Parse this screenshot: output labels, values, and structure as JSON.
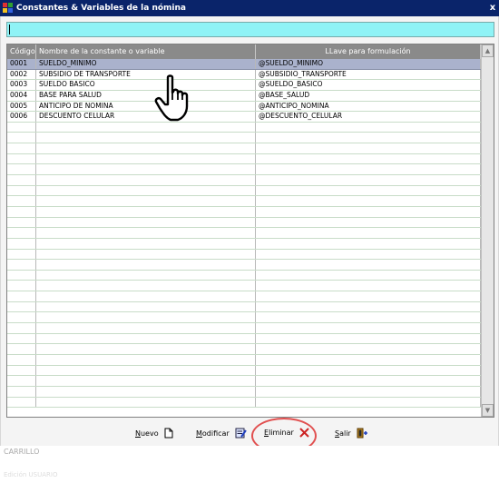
{
  "window": {
    "title": "Constantes & Variables de la nómina",
    "close_label": "x"
  },
  "search": {
    "value": ""
  },
  "grid": {
    "columns": [
      "Código",
      "Nombre de la constante o variable",
      "LLave para formulación"
    ],
    "rows": [
      {
        "codigo": "0001",
        "nombre": "SUELDO_MINIMO",
        "llave": "@SUELDO_MINIMO"
      },
      {
        "codigo": "0002",
        "nombre": "SUBSIDIO DE TRANSPORTE",
        "llave": "@SUBSIDIO_TRANSPORTE"
      },
      {
        "codigo": "0003",
        "nombre": "SUELDO BASICO",
        "llave": "@SUELDO_BASICO"
      },
      {
        "codigo": "0004",
        "nombre": "BASE PARA SALUD",
        "llave": "@BASE_SALUD"
      },
      {
        "codigo": "0005",
        "nombre": "ANTICIPO DE NOMINA",
        "llave": "@ANTICIPO_NOMINA"
      },
      {
        "codigo": "0006",
        "nombre": "DESCUENTO CELULAR",
        "llave": "@DESCUENTO_CELULAR"
      }
    ],
    "selected_row": 0
  },
  "toolbar": {
    "nuevo": {
      "accel": "N",
      "rest": "uevo",
      "icon": "new-document-icon"
    },
    "modificar": {
      "accel": "M",
      "rest": "odificar",
      "icon": "edit-form-icon"
    },
    "eliminar": {
      "accel": "E",
      "rest": "liminar",
      "icon": "delete-x-icon",
      "color": "#cc2222"
    },
    "salir": {
      "accel": "S",
      "rest": "alir",
      "icon": "exit-door-icon"
    }
  },
  "status": {
    "user": "CARRILLO",
    "faint": "Edición   USUARIO"
  },
  "colors": {
    "title_bar": "#0a246a",
    "search_bg": "#8ff3f6",
    "header_bg": "#8a8a8a",
    "selected_bg": "#aab2cc"
  }
}
